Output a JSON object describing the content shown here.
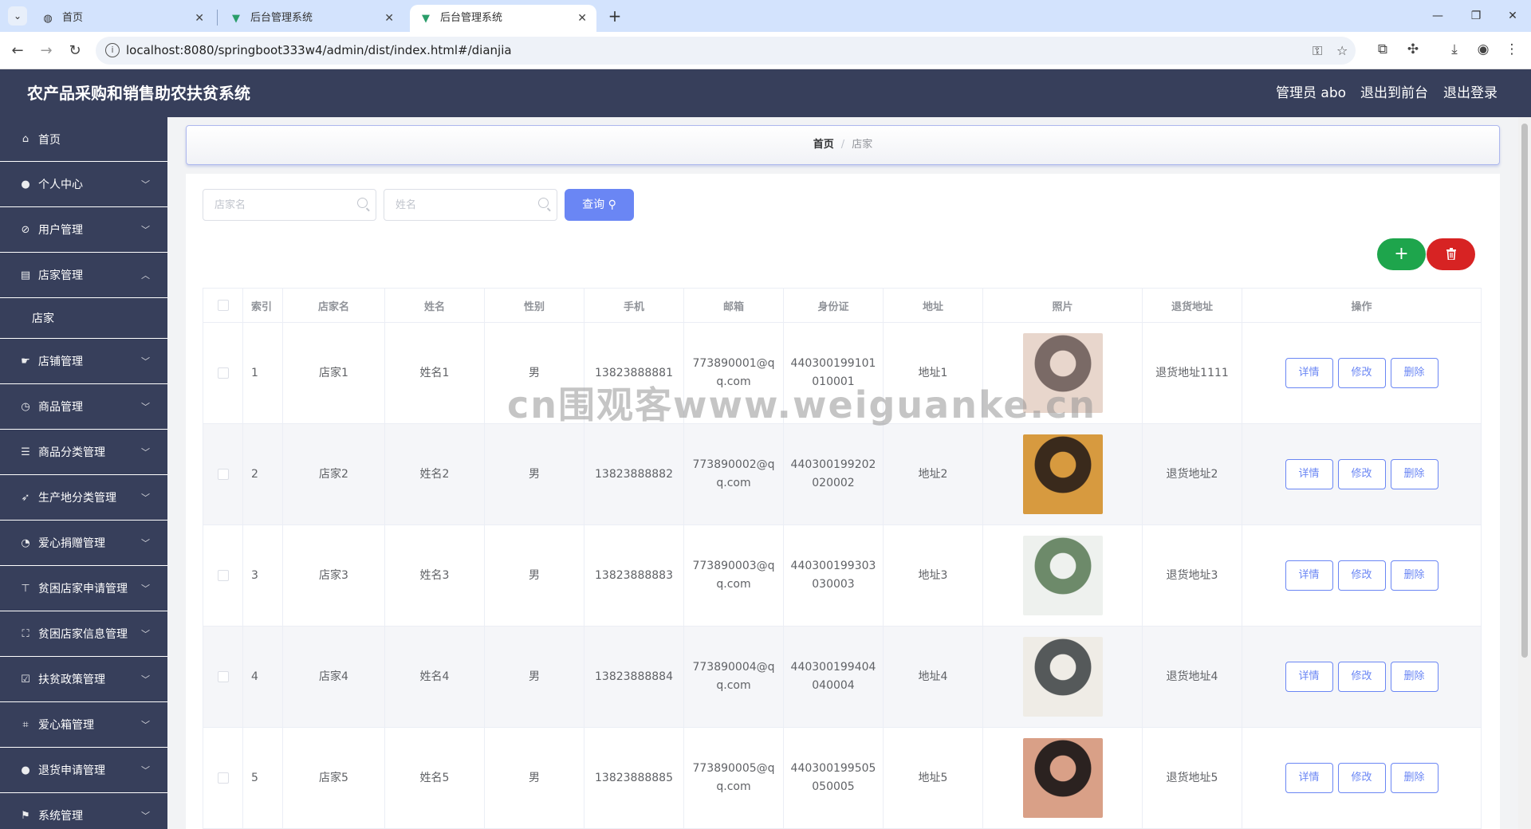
{
  "browser": {
    "tabs": [
      {
        "title": "首页",
        "active": false
      },
      {
        "title": "后台管理系统",
        "active": false
      },
      {
        "title": "后台管理系统",
        "active": true
      }
    ],
    "url": "localhost:8080/springboot333w4/admin/dist/index.html#/dianjia"
  },
  "header": {
    "title": "农产品采购和销售助农扶贫系统",
    "admin_label": "管理员 abo",
    "front_link": "退出到前台",
    "logout_link": "退出登录"
  },
  "sidebar": {
    "items": [
      {
        "label": "首页",
        "icon": "home-icon"
      },
      {
        "label": "个人中心",
        "icon": "user-icon"
      },
      {
        "label": "用户管理",
        "icon": "compass-icon"
      },
      {
        "label": "店家管理",
        "icon": "shop-icon",
        "expanded": true
      },
      {
        "label": "店家",
        "sub": true
      },
      {
        "label": "店铺管理",
        "icon": "thumb-icon"
      },
      {
        "label": "商品管理",
        "icon": "clock-icon"
      },
      {
        "label": "商品分类管理",
        "icon": "list-icon"
      },
      {
        "label": "生产地分类管理",
        "icon": "send-icon"
      },
      {
        "label": "爱心捐赠管理",
        "icon": "gauge-icon"
      },
      {
        "label": "贫困店家申请管理",
        "icon": "stamp-icon"
      },
      {
        "label": "贫困店家信息管理",
        "icon": "frame-icon"
      },
      {
        "label": "扶贫政策管理",
        "icon": "check-square-icon"
      },
      {
        "label": "爱心箱管理",
        "icon": "crop-icon"
      },
      {
        "label": "退货申请管理",
        "icon": "user-icon"
      },
      {
        "label": "系统管理",
        "icon": "flag-icon"
      }
    ]
  },
  "breadcrumb": {
    "home": "首页",
    "current": "店家"
  },
  "search": {
    "shop_placeholder": "店家名",
    "name_placeholder": "姓名",
    "query_label": "查询"
  },
  "actions": {
    "add_label": "+",
    "delete_icon": "trash-icon"
  },
  "table": {
    "columns": [
      "索引",
      "店家名",
      "姓名",
      "性别",
      "手机",
      "邮箱",
      "身份证",
      "地址",
      "照片",
      "退货地址",
      "操作"
    ],
    "row_actions": [
      "详情",
      "修改",
      "删除"
    ],
    "rows": [
      {
        "index": "1",
        "shop": "店家1",
        "name": "姓名1",
        "gender": "男",
        "phone": "13823888881",
        "email": "773890001@qq.com",
        "idcard": "440300199101010001",
        "address": "地址1",
        "return_address": "退货地址1111",
        "photo_colors": [
          "#7a6a66",
          "#e8d6cc"
        ]
      },
      {
        "index": "2",
        "shop": "店家2",
        "name": "姓名2",
        "gender": "男",
        "phone": "13823888882",
        "email": "773890002@qq.com",
        "idcard": "440300199202020002",
        "address": "地址2",
        "return_address": "退货地址2",
        "photo_colors": [
          "#3a2a1c",
          "#d79a3f"
        ]
      },
      {
        "index": "3",
        "shop": "店家3",
        "name": "姓名3",
        "gender": "男",
        "phone": "13823888883",
        "email": "773890003@qq.com",
        "idcard": "440300199303030003",
        "address": "地址3",
        "return_address": "退货地址3",
        "photo_colors": [
          "#6d8a6a",
          "#eef1ee"
        ]
      },
      {
        "index": "4",
        "shop": "店家4",
        "name": "姓名4",
        "gender": "男",
        "phone": "13823888884",
        "email": "773890004@qq.com",
        "idcard": "440300199404040004",
        "address": "地址4",
        "return_address": "退货地址4",
        "photo_colors": [
          "#55595a",
          "#efece6"
        ]
      },
      {
        "index": "5",
        "shop": "店家5",
        "name": "姓名5",
        "gender": "男",
        "phone": "13823888885",
        "email": "773890005@qq.com",
        "idcard": "440300199505050005",
        "address": "地址5",
        "return_address": "退货地址5",
        "photo_colors": [
          "#2b2220",
          "#d9a087"
        ]
      }
    ]
  },
  "watermark": "cn围观客www.weiguanke.cn",
  "colors": {
    "sidebar": "#373f5b",
    "accent": "#6a86f4",
    "add": "#1ea54c",
    "delete": "#d72323"
  }
}
